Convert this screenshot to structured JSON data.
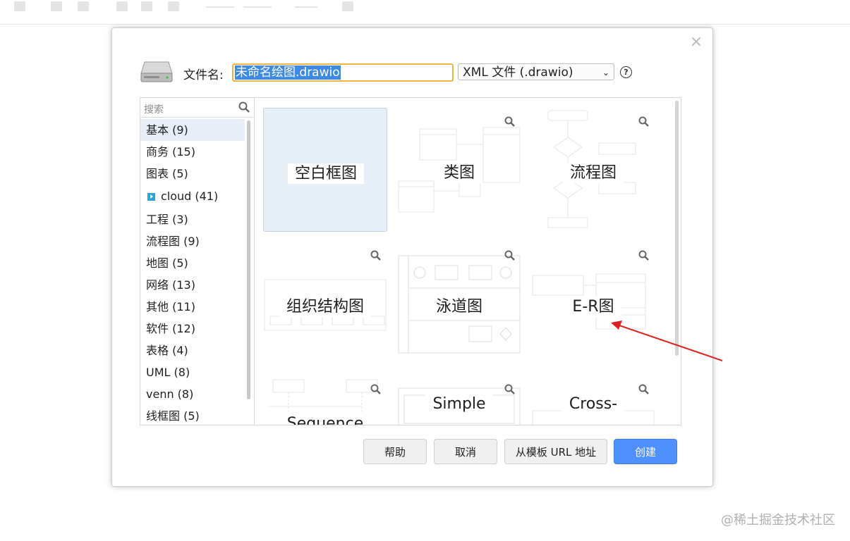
{
  "dialog": {
    "filename_label": "文件名:",
    "filename_value": "未命名绘图.drawio",
    "file_type": "XML 文件 (.drawio)",
    "help_symbol": "?",
    "close_symbol": "×"
  },
  "sidebar": {
    "search_placeholder": "搜索",
    "categories": [
      {
        "label": "基本 (9)"
      },
      {
        "label": "商务 (15)"
      },
      {
        "label": "图表 (5)"
      },
      {
        "label": "cloud (41)"
      },
      {
        "label": "工程 (3)"
      },
      {
        "label": "流程图 (9)"
      },
      {
        "label": "地图 (5)"
      },
      {
        "label": "网络 (13)"
      },
      {
        "label": "其他 (11)"
      },
      {
        "label": "软件 (12)"
      },
      {
        "label": "表格 (4)"
      },
      {
        "label": "UML (8)"
      },
      {
        "label": "venn (8)"
      },
      {
        "label": "线框图 (5)"
      }
    ]
  },
  "templates": [
    {
      "label": "空白框图"
    },
    {
      "label": "类图"
    },
    {
      "label": "流程图"
    },
    {
      "label": "组织结构图"
    },
    {
      "label": "泳道图"
    },
    {
      "label": "E-R图"
    },
    {
      "label": "Sequence"
    },
    {
      "label": "Simple"
    },
    {
      "label": "Cross-"
    }
  ],
  "buttons": {
    "help": "帮助",
    "cancel": "取消",
    "from_url": "从模板 URL 地址",
    "create": "创建"
  },
  "watermark": "@稀土掘金技术社区",
  "colors": {
    "selection_blue": "#3d8ae6",
    "focus_border": "#f3b53d",
    "primary_button": "#4d90fe",
    "annotation_arrow": "#e02020"
  }
}
